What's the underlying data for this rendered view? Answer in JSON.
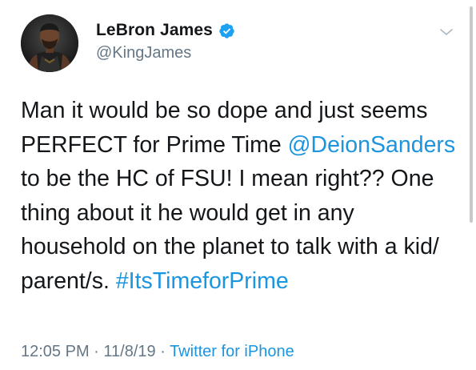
{
  "author": {
    "display_name": "LeBron James",
    "handle": "@KingJames",
    "verified": true,
    "avatar_icon": "profile-photo"
  },
  "tweet": {
    "lines": [
      [
        {
          "text": "Man it would be so dope and just seems"
        }
      ],
      [
        {
          "text": "PERFECT for Prime Time "
        },
        {
          "text": "@DeionSanders",
          "link": true
        }
      ],
      [
        {
          "text": "to be the HC of FSU! I mean right?? One"
        }
      ],
      [
        {
          "text": "thing about it he would get in any"
        }
      ],
      [
        {
          "text": "household on the planet to talk with a kid/"
        }
      ],
      [
        {
          "text": "parent/s. "
        },
        {
          "text": "#ItsTimeforPrime",
          "link": true
        }
      ]
    ]
  },
  "meta": {
    "time": "12:05 PM",
    "separator": " · ",
    "date": "11/8/19",
    "source": "Twitter for iPhone"
  },
  "colors": {
    "text": "#14171a",
    "secondary": "#657786",
    "link": "#1b95e0",
    "verified": "#1da1f2"
  },
  "icons": {
    "verified": "verified-badge-icon",
    "menu": "chevron-down-icon"
  }
}
